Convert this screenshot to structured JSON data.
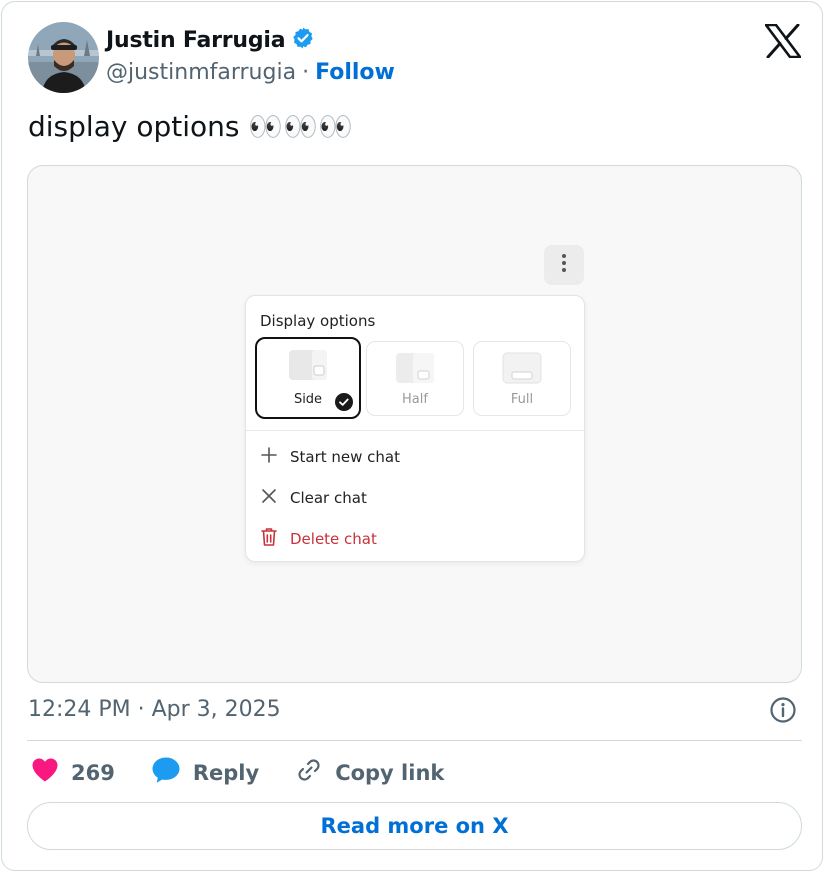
{
  "author": {
    "name": "Justin Farrugia",
    "handle": "@justinmfarrugia",
    "separator": "·",
    "follow_label": "Follow",
    "verified_color": "#1d9bf0"
  },
  "tweet": {
    "text": "display options 👀👀👀"
  },
  "media": {
    "popup_title": "Display options",
    "options": [
      {
        "label": "Side",
        "selected": true
      },
      {
        "label": "Half",
        "selected": false
      },
      {
        "label": "Full",
        "selected": false
      }
    ],
    "menu": [
      {
        "label": "Start new chat",
        "icon": "plus-icon"
      },
      {
        "label": "Clear chat",
        "icon": "x-icon"
      },
      {
        "label": "Delete chat",
        "icon": "trash-icon",
        "color": "#c9323a"
      }
    ]
  },
  "meta": {
    "timestamp": "12:24 PM · Apr 3, 2025"
  },
  "actions": {
    "like_count": "269",
    "reply_label": "Reply",
    "copy_label": "Copy link",
    "like_color": "#f91880",
    "reply_color": "#1d9bf0"
  },
  "read_more_label": "Read more on X"
}
